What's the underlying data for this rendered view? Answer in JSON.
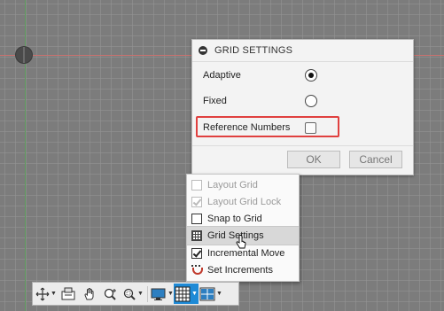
{
  "canvas": {
    "grid_color": "#969696",
    "background_color": "#7c7c7c",
    "x_axis_color": "#c9726f",
    "y_axis_color": "#5c9a5c"
  },
  "grid_panel": {
    "title": "GRID SETTINGS",
    "options": [
      {
        "label": "Adaptive",
        "type": "radio",
        "selected": true
      },
      {
        "label": "Fixed",
        "type": "radio",
        "selected": false
      },
      {
        "label": "Reference Numbers",
        "type": "checkbox",
        "checked": false,
        "highlighted": true
      }
    ],
    "ok_label": "OK",
    "cancel_label": "Cancel",
    "highlight_color": "#e0403f"
  },
  "grid_menu": {
    "items": [
      {
        "label": "Layout Grid",
        "checked": false,
        "disabled": true
      },
      {
        "label": "Layout Grid Lock",
        "checked": true,
        "disabled": true
      },
      {
        "label": "Snap to Grid",
        "checked": false,
        "disabled": false
      },
      {
        "label": "Grid Settings",
        "icon": "grid-icon",
        "hovered": true
      },
      {
        "label": "Incremental Move",
        "checked": true,
        "disabled": false
      },
      {
        "label": "Set Increments",
        "icon": "magnet-icon"
      }
    ]
  },
  "toolbar": {
    "active_color": "#1e8ad6",
    "tools": [
      {
        "icon": "orbit-icon",
        "has_dropdown": true
      },
      {
        "icon": "look-at-icon",
        "has_dropdown": false
      },
      {
        "icon": "pan-hand-icon",
        "has_dropdown": false
      },
      {
        "icon": "zoom-icon",
        "has_dropdown": false
      },
      {
        "icon": "fit-window-icon",
        "has_dropdown": true
      },
      {
        "icon": "display-settings-icon",
        "has_dropdown": true
      },
      {
        "icon": "grid-snaps-icon",
        "has_dropdown": true,
        "active": true
      },
      {
        "icon": "viewports-icon",
        "has_dropdown": true
      }
    ]
  }
}
